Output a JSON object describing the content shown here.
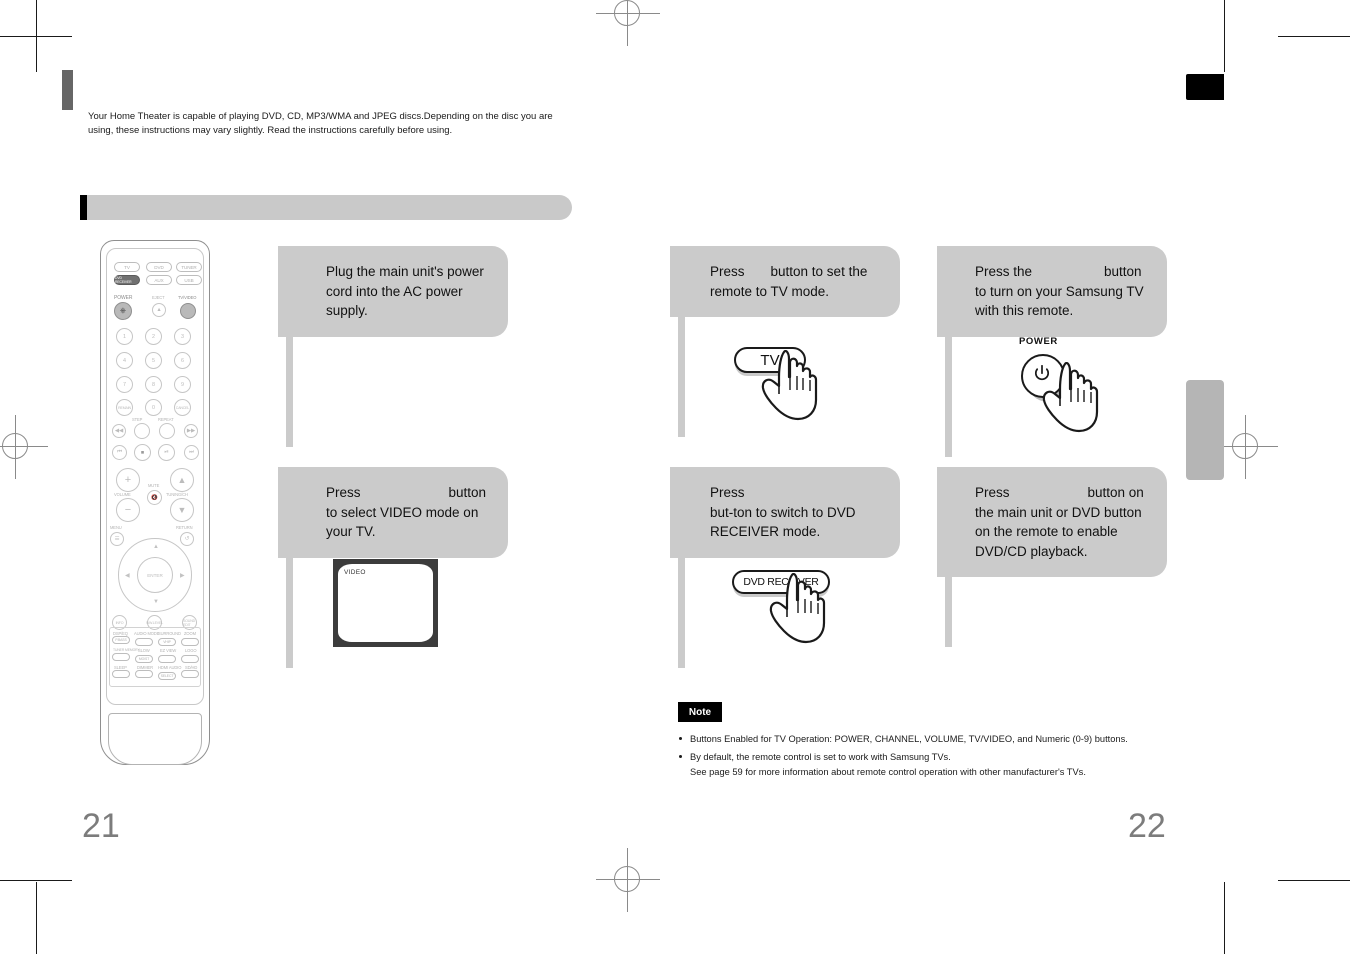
{
  "document": {
    "intro_text": "Your Home Theater is capable of playing DVD, CD, MP3/WMA and JPEG discs.Depending on the disc you are using, these instructions may vary slightly. Read the instructions carefully before using.",
    "section_title": "",
    "page_left": "21",
    "page_right": "22"
  },
  "steps": {
    "plug_power": {
      "text": "Plug the main unit's power cord into the AC power supply."
    },
    "select_video": {
      "text_before": "Press",
      "text_after": "button to select VIDEO mode on your TV.",
      "tv_osd": "VIDEO"
    },
    "tv_mode": {
      "text_before": "Press",
      "text_after": "button to set the remote to TV mode.",
      "button_label": "TV"
    },
    "dvd_receiver_mode": {
      "text_before": "Press",
      "text_after": "but-ton to switch to DVD RECEIVER mode.",
      "button_label": "DVD RECEIVER"
    },
    "power_on_tv": {
      "text_before": "Press the",
      "text_after": "button to turn on your Samsung TV with this remote.",
      "button_label": "POWER"
    },
    "enable_playback": {
      "text_before": "Press",
      "text_after": "button on the main unit or DVD button on the remote to enable DVD/CD playback."
    }
  },
  "note": {
    "tag_label": "Note",
    "items": [
      {
        "text": "Buttons Enabled for TV Operation: POWER, CHANNEL, VOLUME, TV/VIDEO, and Numeric (0-9) buttons.",
        "continuation": ""
      },
      {
        "text": "By default, the remote control is set to work with Samsung TVs.",
        "continuation": "See page 59 for more information about remote control operation with other manufacturer's TVs."
      }
    ]
  },
  "remote": {
    "source_buttons": [
      "TV",
      "DVD",
      "TUNER",
      "DVD RECEIVER",
      "AUX",
      "USB"
    ],
    "top_labels": {
      "power": "POWER",
      "eject": "EJECT",
      "tvvideo": "TV/VIDEO"
    },
    "numeric": [
      "1",
      "2",
      "3",
      "4",
      "5",
      "6",
      "7",
      "8",
      "9"
    ],
    "numeric_row4": [
      "REMAIN",
      "0",
      "CANCEL"
    ],
    "transport_labels": [
      "STEP",
      "REPEAT"
    ],
    "volume_label": "VOLUME",
    "mute_label": "MUTE",
    "tuning_label": "TUNING/CH",
    "menu_label": "MENU",
    "return_label": "RETURN",
    "enter_label": "ENTER",
    "mid_buttons": [
      "INFO",
      "S/W.LEVEL",
      "SOUND EDIT"
    ],
    "function_labels": [
      "DSP/EQ",
      "AUDIO MODE",
      "SURROUND",
      "ZOOM",
      "TUNER MEMORY",
      "SLOW",
      "EZ VIEW",
      "LOGO",
      "SLEEP",
      "DIMMER",
      "HDMI AUDIO",
      "SD/HD"
    ],
    "function_inner": [
      "P.BASS",
      "VHIP",
      "MO/ST",
      "SELECT"
    ]
  },
  "colors": {
    "bubble_gray": "#cbcbcb",
    "title_gray": "#c9c9c9",
    "page_number_gray": "#7c7c7c",
    "tab_black": "#000000"
  }
}
